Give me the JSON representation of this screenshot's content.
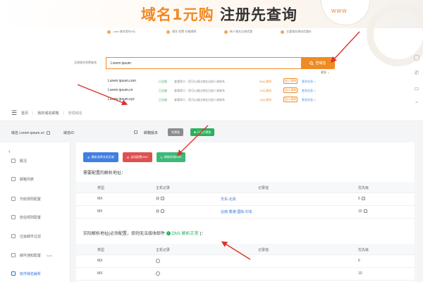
{
  "banner": {
    "title_part1": "域名1元购",
    "title_part2": "注册先查询",
    "deco_text": "www",
    "features": [
      {
        "text": ".com 域名首年9元"
      },
      {
        "text": "域名 续费 价格透明"
      },
      {
        "text": "新人域名注册优惠"
      },
      {
        "text": "主要域名建站优惠价"
      }
    ]
  },
  "search": {
    "label": "注册域名免费查询",
    "value": "Lorem ipsum",
    "button_label": "查域名",
    "more_label": "更多"
  },
  "results": [
    {
      "domain": "Lorem ipsum.com",
      "status": "已注册",
      "desc": "查看简介，您可以通过域名注册人来联系",
      "price": "38元/首年",
      "pill": "加入清单",
      "link": "更多信息 >"
    },
    {
      "domain": "Lorem ipsum.cn",
      "status": "已注册",
      "desc": "查看简介，您可以通过域名注册人来联系",
      "price": "19元/首年",
      "pill": "加入清单",
      "link": "更多信息 >"
    },
    {
      "domain": "Lorem ipsum.xyz",
      "status": "已注册",
      "desc": "查看简介，您可以通过域名注册人来联系",
      "price": "13元/首年",
      "pill": "加入清单",
      "link": "更多信息 >"
    }
  ],
  "breadcrumb": {
    "home": "首页",
    "parent": "我的域名邮箱",
    "current": "管理域名"
  },
  "infobar": {
    "domain_label": "域名",
    "domain_value": "Lorem ipsum.cn",
    "alias_label": "域名ID",
    "version_label": "邮箱版本",
    "version_badge": "免费版",
    "open_button": "开通付费版"
  },
  "sidebar": {
    "items": [
      {
        "label": "概况",
        "tag": ""
      },
      {
        "label": "邮箱列表",
        "tag": ""
      },
      {
        "label": "代收规则配置",
        "tag": ""
      },
      {
        "label": "收信规则配置",
        "tag": ""
      },
      {
        "label": "垃圾邮件过滤",
        "tag": ""
      },
      {
        "label": "邮件通知配置",
        "tag": "Beta"
      },
      {
        "label": "收件域名解析",
        "tag": ""
      }
    ]
  },
  "main": {
    "buttons": [
      {
        "label": "重新选择业务区域"
      },
      {
        "label": "自动配置DNS"
      },
      {
        "label": "刷新检测DNS"
      }
    ],
    "section1_title": "需要配置的解析地址：",
    "section2_title_prefix": "实际解析地址(必须配置，否则无法接收邮件",
    "section2_status": "DNS 解析正常",
    "section2_title_suffix": ")：",
    "columns": [
      "类型",
      "主机记录",
      "记录值",
      "优先级"
    ],
    "table1": [
      {
        "type": "MX",
        "host": "@",
        "value": "华东-北京",
        "priority": "5"
      },
      {
        "type": "MX",
        "host": "@",
        "value": "云南·香港·国际·印东",
        "priority": "10"
      }
    ],
    "table2": [
      {
        "type": "MX",
        "host": "",
        "value": "",
        "priority": "5"
      },
      {
        "type": "MX",
        "host": "",
        "value": "",
        "priority": "10"
      }
    ]
  },
  "colors": {
    "accent_orange": "#f08a24",
    "primary_blue": "#3f7fe0",
    "danger_red": "#e15050",
    "success_green": "#2bb05c",
    "annotation_red": "#d9342b"
  }
}
